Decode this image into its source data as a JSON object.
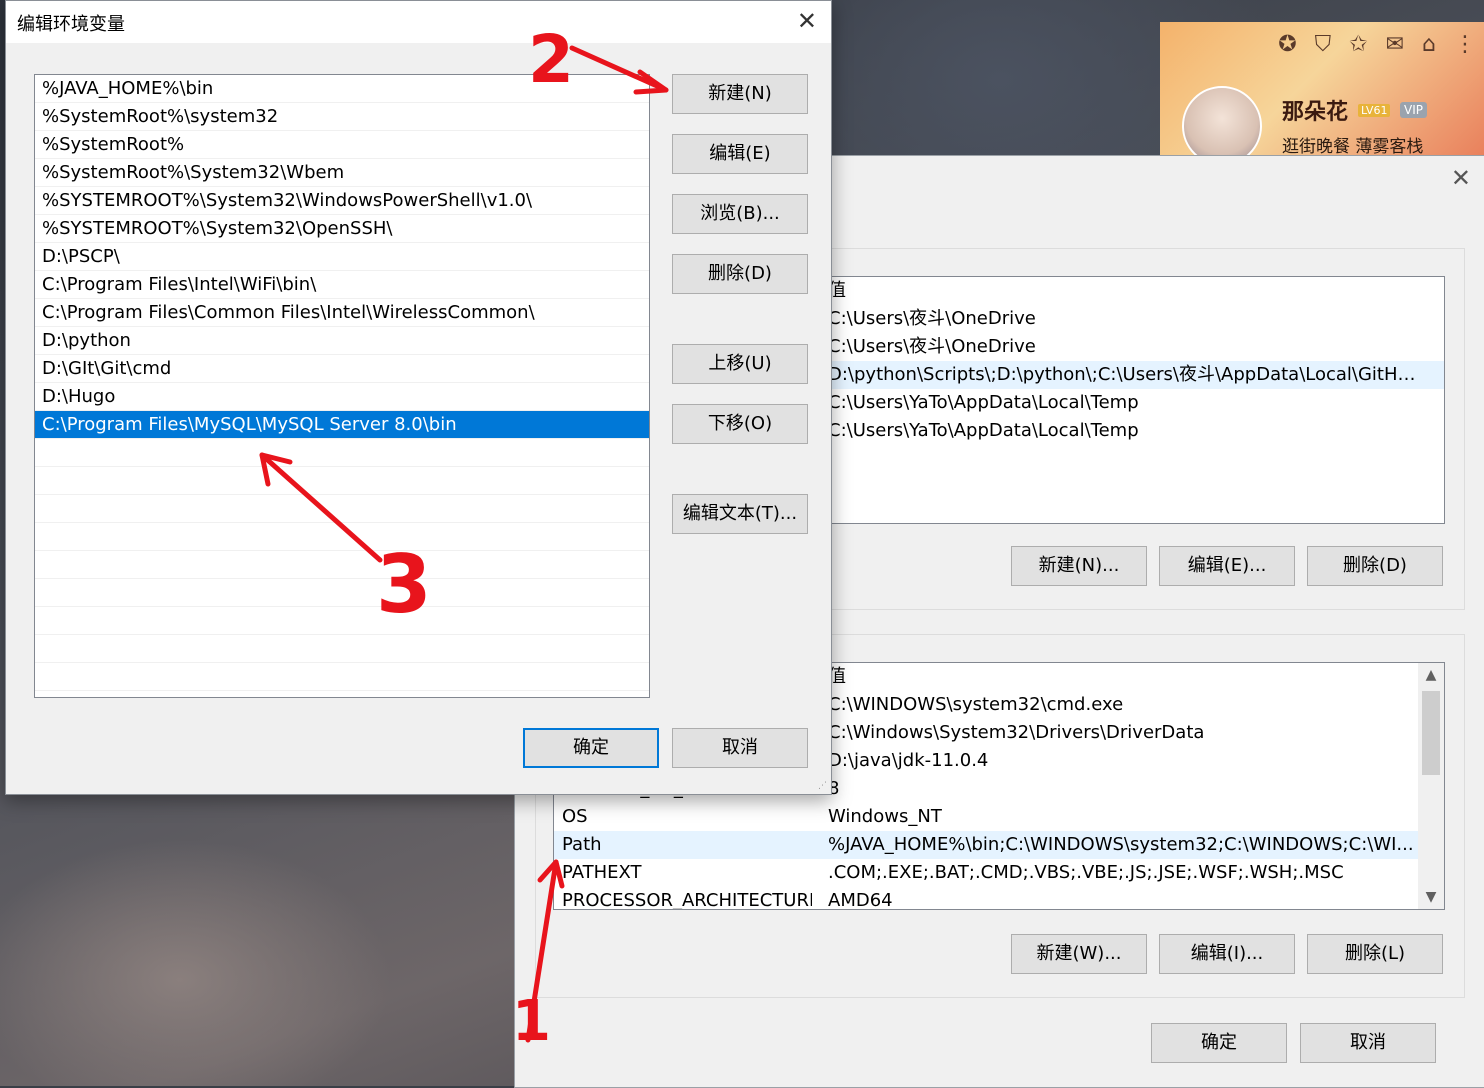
{
  "profile": {
    "name": "那朵花",
    "level": "LV61",
    "vip": "VIP",
    "tagline": "逛街晚餐 薄雾客栈",
    "icons": [
      "medal-icon",
      "shirt-icon",
      "star-badge-icon",
      "mail-icon",
      "shop-icon",
      "more-icon"
    ]
  },
  "edit_dialog": {
    "title": "编辑环境变量",
    "close": "✕",
    "paths": [
      "%JAVA_HOME%\\bin",
      "%SystemRoot%\\system32",
      "%SystemRoot%",
      "%SystemRoot%\\System32\\Wbem",
      "%SYSTEMROOT%\\System32\\WindowsPowerShell\\v1.0\\",
      "%SYSTEMROOT%\\System32\\OpenSSH\\",
      "D:\\PSCP\\",
      "C:\\Program Files\\Intel\\WiFi\\bin\\",
      "C:\\Program Files\\Common Files\\Intel\\WirelessCommon\\",
      "D:\\python",
      "D:\\GIt\\Git\\cmd",
      "D:\\Hugo",
      "C:\\Program Files\\MySQL\\MySQL Server 8.0\\bin"
    ],
    "selected_index": 12,
    "buttons": {
      "new": "新建(N)",
      "edit": "编辑(E)",
      "browse": "浏览(B)...",
      "delete": "删除(D)",
      "move_up": "上移(U)",
      "move_down": "下移(O)",
      "edit_text": "编辑文本(T)...",
      "ok": "确定",
      "cancel": "取消"
    }
  },
  "env_dialog": {
    "close": "✕",
    "user_vars": {
      "header_value": "值",
      "rows": [
        {
          "name": "",
          "value": "C:\\Users\\夜斗\\OneDrive"
        },
        {
          "name": "",
          "value": "C:\\Users\\夜斗\\OneDrive"
        },
        {
          "name": "",
          "value": "D:\\python\\Scripts\\;D:\\python\\;C:\\Users\\夜斗\\AppData\\Local\\GitHu..."
        },
        {
          "name": "",
          "value": "C:\\Users\\YaTo\\AppData\\Local\\Temp"
        },
        {
          "name": "",
          "value": "C:\\Users\\YaTo\\AppData\\Local\\Temp"
        }
      ],
      "buttons": {
        "new": "新建(N)...",
        "edit": "编辑(E)...",
        "delete": "删除(D)"
      }
    },
    "sys_vars": {
      "header_value": "值",
      "rows": [
        {
          "name": "",
          "value": "C:\\WINDOWS\\system32\\cmd.exe"
        },
        {
          "name": "",
          "value": "C:\\Windows\\System32\\Drivers\\DriverData"
        },
        {
          "name": "",
          "value": "D:\\java\\jdk-11.0.4"
        },
        {
          "name": "NUMBER_OF_PROCESSORS",
          "value": "8"
        },
        {
          "name": "OS",
          "value": "Windows_NT"
        },
        {
          "name": "Path",
          "value": "%JAVA_HOME%\\bin;C:\\WINDOWS\\system32;C:\\WINDOWS;C:\\WI..."
        },
        {
          "name": "PATHEXT",
          "value": ".COM;.EXE;.BAT;.CMD;.VBS;.VBE;.JS;.JSE;.WSF;.WSH;.MSC"
        },
        {
          "name": "PROCESSOR_ARCHITECTURE",
          "value": "AMD64"
        }
      ],
      "buttons": {
        "new": "新建(W)...",
        "edit": "编辑(I)...",
        "delete": "删除(L)"
      }
    },
    "ok": "确定",
    "cancel": "取消"
  },
  "annotations": [
    "2",
    "3",
    "1"
  ],
  "colors": {
    "selection": "#0078d7",
    "annotation": "#e8141c"
  }
}
